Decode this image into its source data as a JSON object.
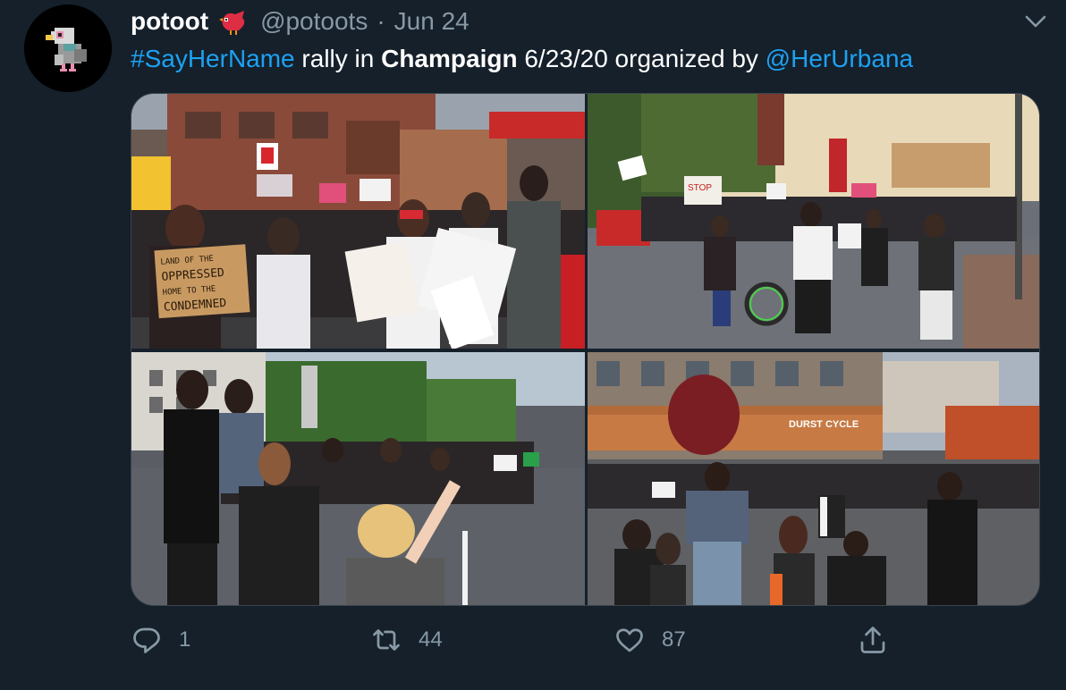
{
  "tweet": {
    "display_name": "potoot",
    "handle": "@potoots",
    "separator": "·",
    "date": "Jun 24",
    "text": {
      "hashtag": "#SayHerName",
      "part1": " rally in ",
      "location": "Champaign",
      "part2": " 6/23/20 organized by ",
      "mention": "@HerUrbana"
    },
    "sign_texts": {
      "sign1": "LAND OF THE",
      "sign2": "OPPRESSED",
      "sign3": "HOME TO THE",
      "sign4": "CONDEMNED",
      "stop_sign": "STOP",
      "store": "DURST CYCLE"
    },
    "stats": {
      "replies": "1",
      "retweets": "44",
      "likes": "87"
    }
  },
  "colors": {
    "background": "#15202b",
    "secondary_text": "#8899a6",
    "link": "#1da1f2",
    "border": "#38444d"
  },
  "icons": {
    "reply": "reply-icon",
    "retweet": "retweet-icon",
    "like": "heart-icon",
    "share": "share-icon",
    "more": "chevron-down-icon",
    "emoji": "bird-emoji-icon"
  }
}
